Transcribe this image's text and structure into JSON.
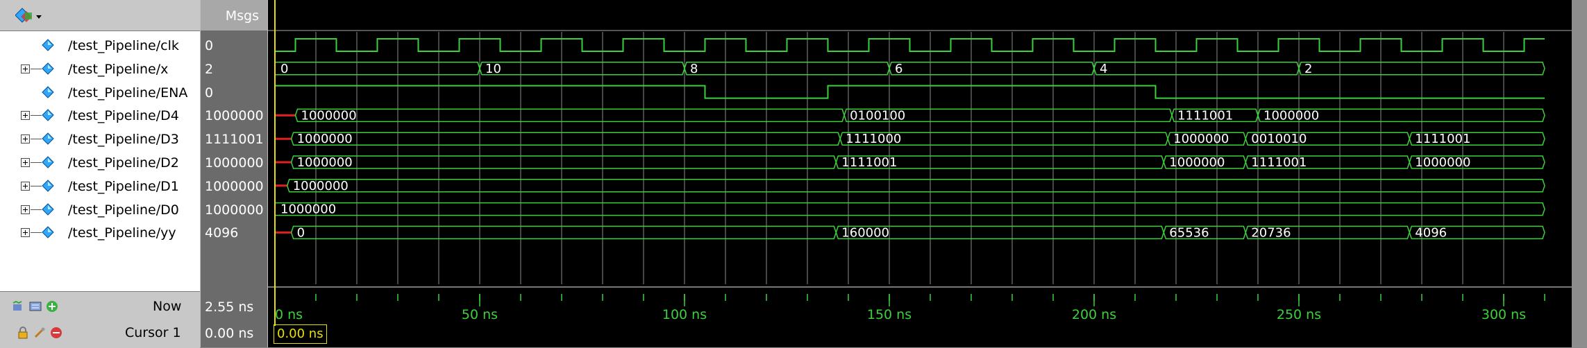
{
  "header": {
    "msgs_label": "Msgs"
  },
  "signals": [
    {
      "name": "/test_Pipeline/clk",
      "value": "0",
      "expandable": false
    },
    {
      "name": "/test_Pipeline/x",
      "value": "2",
      "expandable": true
    },
    {
      "name": "/test_Pipeline/ENA",
      "value": "0",
      "expandable": false
    },
    {
      "name": "/test_Pipeline/D4",
      "value": "1000000",
      "expandable": true
    },
    {
      "name": "/test_Pipeline/D3",
      "value": "1111001",
      "expandable": true
    },
    {
      "name": "/test_Pipeline/D2",
      "value": "1000000",
      "expandable": true
    },
    {
      "name": "/test_Pipeline/D1",
      "value": "1000000",
      "expandable": true
    },
    {
      "name": "/test_Pipeline/D0",
      "value": "1000000",
      "expandable": true
    },
    {
      "name": "/test_Pipeline/yy",
      "value": "4096",
      "expandable": true
    }
  ],
  "footer": {
    "now_label": "Now",
    "now_value": "2.55 ns",
    "cursor_label": "Cursor 1",
    "cursor_value": "0.00 ns",
    "cursor_time_box": "0.00 ns"
  },
  "timeline": {
    "labels": [
      "0 ns",
      "50 ns",
      "100 ns",
      "150 ns",
      "200 ns",
      "250 ns",
      "300 ns"
    ],
    "colors": {
      "wave": "#3bd13b",
      "ruler": "#3bd13b",
      "cursor": "#e8e000",
      "grid": "#ffffff"
    }
  },
  "waves": {
    "clk": {
      "period_ns": 20,
      "first_high_ns": 5
    },
    "x": [
      {
        "t": 0,
        "v": "0"
      },
      {
        "t": 50,
        "v": "10"
      },
      {
        "t": 100,
        "v": "8"
      },
      {
        "t": 150,
        "v": "6"
      },
      {
        "t": 200,
        "v": "4"
      },
      {
        "t": 250,
        "v": "2"
      }
    ],
    "ENA": [
      {
        "t": 0,
        "level": 1
      },
      {
        "t": 105,
        "level": 0
      },
      {
        "t": 135,
        "level": 1
      },
      {
        "t": 215,
        "level": 0
      }
    ],
    "D4": [
      {
        "t": 0,
        "v": ""
      },
      {
        "t": 5,
        "v": "1000000"
      },
      {
        "t": 139,
        "v": "0100100"
      },
      {
        "t": 219,
        "v": "1111001"
      },
      {
        "t": 240,
        "v": "1000000"
      }
    ],
    "D3": [
      {
        "t": 0,
        "v": ""
      },
      {
        "t": 4,
        "v": "1000000"
      },
      {
        "t": 138,
        "v": "1111000"
      },
      {
        "t": 218,
        "v": "1000000"
      },
      {
        "t": 237,
        "v": "0010010"
      },
      {
        "t": 277,
        "v": "1111001"
      }
    ],
    "D2": [
      {
        "t": 0,
        "v": ""
      },
      {
        "t": 4,
        "v": "1000000"
      },
      {
        "t": 137,
        "v": "1111001"
      },
      {
        "t": 217,
        "v": "1000000"
      },
      {
        "t": 237,
        "v": "1111001"
      },
      {
        "t": 277,
        "v": "1000000"
      }
    ],
    "D1": [
      {
        "t": 0,
        "v": ""
      },
      {
        "t": 3,
        "v": "1000000"
      }
    ],
    "D0": [
      {
        "t": 0,
        "v": "1000000"
      }
    ],
    "yy": [
      {
        "t": 0,
        "v": ""
      },
      {
        "t": 4,
        "v": "0"
      },
      {
        "t": 137,
        "v": "160000"
      },
      {
        "t": 217,
        "v": "65536"
      },
      {
        "t": 237,
        "v": "20736"
      },
      {
        "t": 277,
        "v": "4096"
      }
    ]
  }
}
